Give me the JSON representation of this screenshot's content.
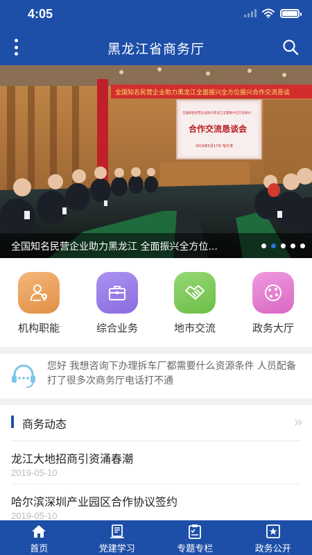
{
  "status_bar": {
    "time": "4:05"
  },
  "nav": {
    "title": "黑龙江省商务厅",
    "menu_icon": "more-vertical-icon",
    "search_icon": "search-icon"
  },
  "banner": {
    "caption": "全国知名民营企业助力黑龙江 全面振兴全方位...",
    "slide_count": 5,
    "active_slide": 2,
    "photo": {
      "wall_banner": "全国知名民营企业助力黑龙江全面振兴全方位振兴合作交流恳谈",
      "screen_line": "全国知名民营企业助力黑龙江全面振兴全方位振兴",
      "screen_title": "合作交流恳谈会",
      "screen_date": "2019年5月17日  哈尔滨"
    }
  },
  "quick_menu": [
    {
      "label": "机构职能",
      "icon": "person-pin-icon",
      "color": "#eda25b"
    },
    {
      "label": "综合业务",
      "icon": "briefcase-icon",
      "color": "#9b7fe6"
    },
    {
      "label": "地市交流",
      "icon": "handshake-icon",
      "color": "#7fcb5c"
    },
    {
      "label": "政务大厅",
      "icon": "hall-icon",
      "color": "#e57fcf"
    }
  ],
  "message": {
    "icon": "customer-service-icon",
    "text": "您好 我想咨询下办理拆车厂都需要什么资源条件 人员配备 打了很多次商务厅电话打不通"
  },
  "news": {
    "title": "商务动态",
    "more_icon": "double-chevron-right-icon",
    "items": [
      {
        "title": "龙江大地招商引资涌春潮",
        "date": "2019-05-10"
      },
      {
        "title": "哈尔滨深圳产业园区合作协议签约",
        "date": "2019-05-10"
      }
    ]
  },
  "tabs": [
    {
      "label": "首页",
      "icon": "home-icon",
      "active": true
    },
    {
      "label": "党建学习",
      "icon": "book-icon",
      "active": false
    },
    {
      "label": "专题专栏",
      "icon": "clipboard-icon",
      "active": false
    },
    {
      "label": "政务公开",
      "icon": "star-icon",
      "active": false
    }
  ],
  "colors": {
    "primary": "#1d4fa8",
    "background": "#f2f2f2",
    "dot_active": "#2c6fd6"
  }
}
